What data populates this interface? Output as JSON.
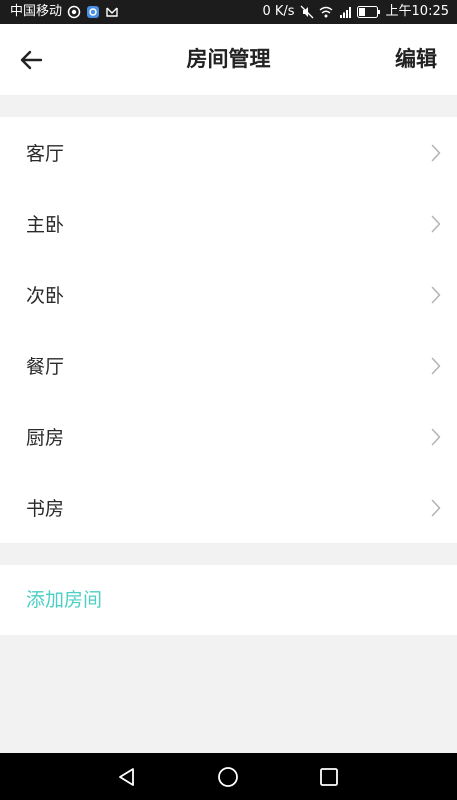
{
  "status_bar": {
    "carrier": "中国移动",
    "speed": "0 K/s",
    "time": "上午10:25",
    "network": "4G"
  },
  "header": {
    "title": "房间管理",
    "edit_label": "编辑",
    "back_icon": "back-arrow-icon"
  },
  "rooms": [
    {
      "label": "客厅"
    },
    {
      "label": "主卧"
    },
    {
      "label": "次卧"
    },
    {
      "label": "餐厅"
    },
    {
      "label": "厨房"
    },
    {
      "label": "书房"
    }
  ],
  "add_room": {
    "label": "添加房间",
    "color": "#4ccfc6"
  },
  "nav_bar": {
    "back_icon": "triangle-back-icon",
    "home_icon": "circle-home-icon",
    "recents_icon": "square-recents-icon"
  },
  "colors": {
    "background": "#f2f2f2",
    "card": "#ffffff",
    "accent": "#4ccfc6",
    "status_bar": "#1c1c1c",
    "nav_bar": "#000000"
  }
}
